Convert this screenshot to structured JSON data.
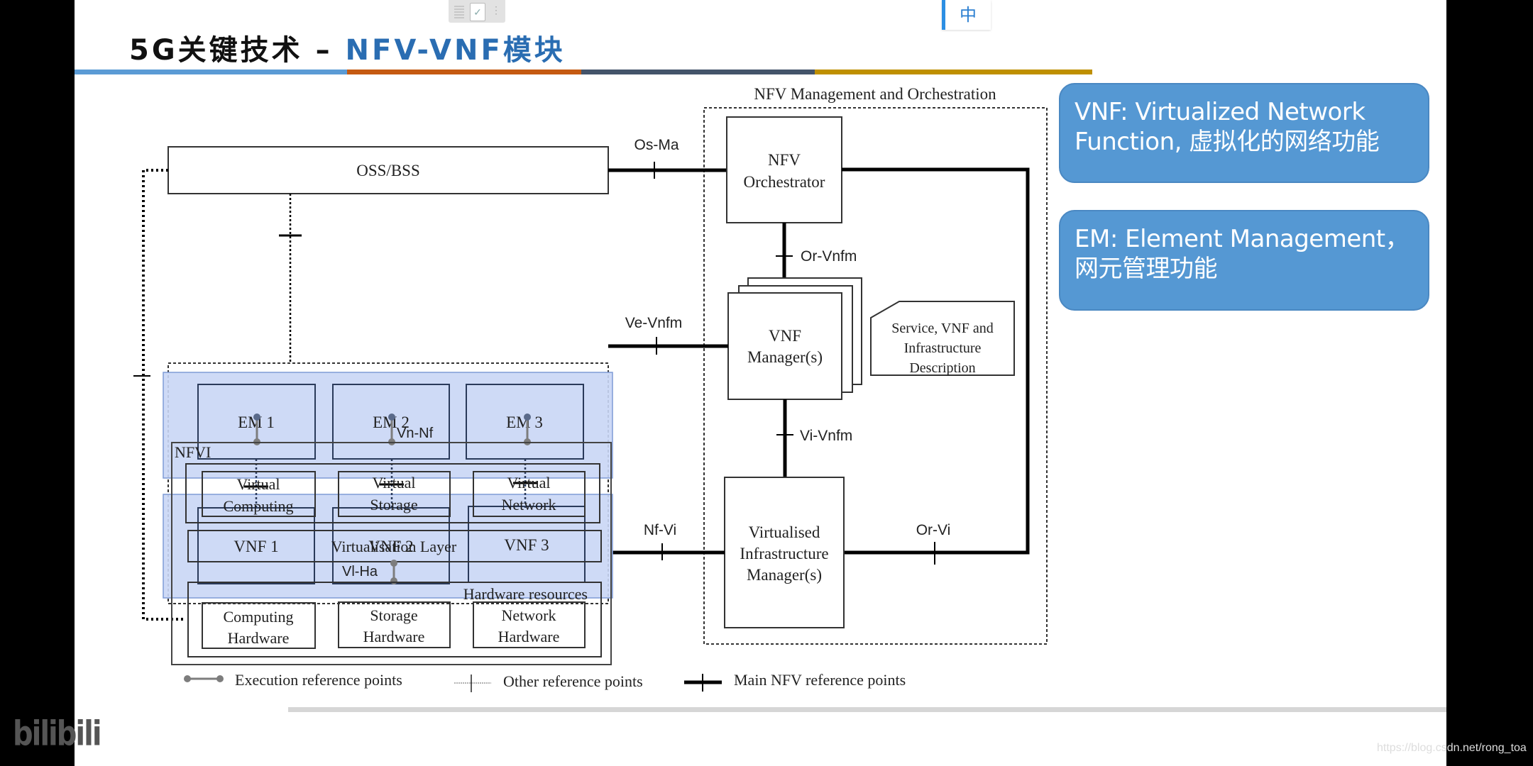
{
  "slide": {
    "title_black": "5G关键技术 – ",
    "title_blue": "NFV-VNF模块",
    "rule_colors": [
      "#5b9bd5",
      "#c55a11",
      "#44546a",
      "#bf9000"
    ]
  },
  "overlay": {
    "ime_indicator": "中",
    "toolbar_icon": "edit-card-icon",
    "watermark_logo": "bilibili",
    "watermark_url": "https://blog.csdn.net/rong_toa"
  },
  "notes": [
    {
      "text_line1": "VNF: Virtualized Network",
      "text_line2": "Function, 虚拟化的网络功能"
    },
    {
      "text_line1": "EM: Element Management，",
      "text_line2": "网元管理功能"
    }
  ],
  "diagram": {
    "oss_bss": "OSS/BSS",
    "mano_title": "NFV Management and Orchestration",
    "nfvo": [
      "NFV",
      "Orchestrator"
    ],
    "vnfm": [
      "VNF",
      "Manager(s)"
    ],
    "vim": [
      "Virtualised",
      "Infrastructure",
      "Manager(s)"
    ],
    "descriptor": [
      "Service, VNF and",
      "Infrastructure",
      "Description"
    ],
    "ems": [
      "EM 1",
      "EM 2",
      "EM 3"
    ],
    "vnfs": [
      "VNF 1",
      "VNF 2",
      "VNF 3"
    ],
    "nfvi": "NFVI",
    "virtual_resources": [
      [
        "Virtual",
        "Computing"
      ],
      [
        "Virtual",
        "Storage"
      ],
      [
        "Virtual",
        "Network"
      ]
    ],
    "virtualisation_layer": "Virtualisation Layer",
    "hardware_resources": "Hardware resources",
    "hardware": [
      [
        "Computing",
        "Hardware"
      ],
      [
        "Storage",
        "Hardware"
      ],
      [
        "Network",
        "Hardware"
      ]
    ],
    "ref_points": {
      "os_ma": "Os-Ma",
      "ve_vnfm": "Ve-Vnfm",
      "or_vnfm": "Or-Vnfm",
      "vi_vnfm": "Vi-Vnfm",
      "nf_vi": "Nf-Vi",
      "or_vi": "Or-Vi",
      "vn_nf": "Vn-Nf",
      "vi_ha": "Vl-Ha"
    },
    "legend": {
      "execution": "Execution reference points",
      "other": "Other reference points",
      "main": "Main NFV reference points"
    },
    "colors": {
      "highlight_fill": "#c9d6f5",
      "highlight_border": "#7f9bd6",
      "execution_gray": "#7d7d7d"
    }
  }
}
